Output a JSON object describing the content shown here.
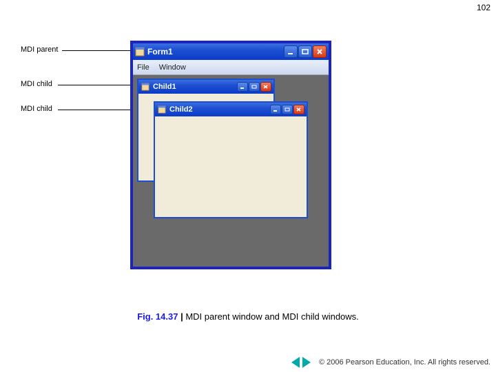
{
  "page_number": "102",
  "callouts": {
    "parent": "MDI parent",
    "child1": "MDI child",
    "child2": "MDI child"
  },
  "parent_window": {
    "title": "Form1",
    "menu": {
      "file": "File",
      "window": "Window"
    }
  },
  "child1": {
    "title": "Child1"
  },
  "child2": {
    "title": "Child2"
  },
  "caption": {
    "fig_num": "Fig. 14.37",
    "pipe": "|",
    "text": "MDI parent window and MDI child windows."
  },
  "copyright": "© 2006 Pearson Education, Inc.  All rights reserved."
}
